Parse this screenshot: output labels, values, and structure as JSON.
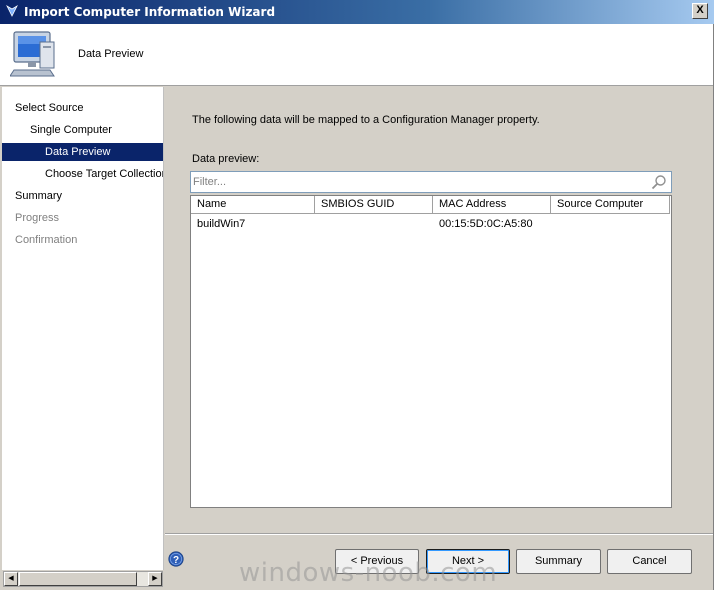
{
  "window": {
    "title": "Import Computer Information Wizard",
    "close_label": "X"
  },
  "header": {
    "title": "Data Preview",
    "icon": "computer-icon"
  },
  "sidebar": {
    "items": [
      {
        "label": "Select Source",
        "level": 0,
        "state": "normal"
      },
      {
        "label": "Single Computer",
        "level": 1,
        "state": "normal"
      },
      {
        "label": "Data Preview",
        "level": 2,
        "state": "selected"
      },
      {
        "label": "Choose Target Collection",
        "level": 2,
        "state": "normal"
      },
      {
        "label": "Summary",
        "level": 0,
        "state": "normal"
      },
      {
        "label": "Progress",
        "level": 0,
        "state": "disabled"
      },
      {
        "label": "Confirmation",
        "level": 0,
        "state": "disabled"
      }
    ]
  },
  "main": {
    "intro": "The following data will be mapped to a Configuration Manager property.",
    "data_preview_label": "Data preview:",
    "filter_placeholder": "Filter...",
    "columns": [
      "Name",
      "SMBIOS GUID",
      "MAC Address",
      "Source Computer"
    ],
    "rows": [
      [
        "buildWin7",
        "",
        "00:15:5D:0C:A5:80",
        ""
      ]
    ]
  },
  "buttons": {
    "previous": "< Previous",
    "next": "Next >",
    "summary": "Summary",
    "cancel": "Cancel"
  },
  "watermark": "windows-noob.com",
  "colors": {
    "titlebar": "#0a246a",
    "selection": "#0a246a",
    "chrome": "#d4d0c8"
  }
}
